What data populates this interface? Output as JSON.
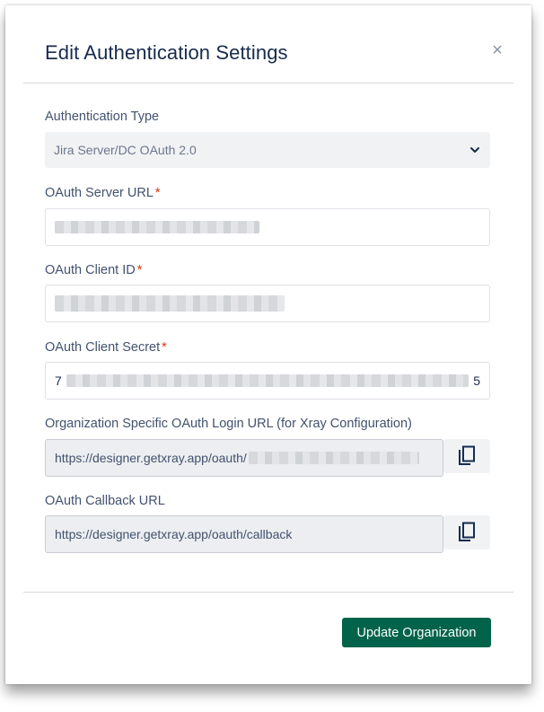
{
  "dialog": {
    "title": "Edit Authentication Settings",
    "close_glyph": "×"
  },
  "fields": {
    "auth_type": {
      "label": "Authentication Type",
      "value": "Jira Server/DC OAuth 2.0"
    },
    "server_url": {
      "label": "OAuth Server URL",
      "required_mark": "*"
    },
    "client_id": {
      "label": "OAuth Client ID",
      "required_mark": "*"
    },
    "client_secret": {
      "label": "OAuth Client Secret",
      "required_mark": "*",
      "value_start": "7",
      "value_end": "5"
    },
    "login_url": {
      "label": "Organization Specific OAuth Login URL (for Xray Configuration)",
      "value": "https://designer.getxray.app/oauth/"
    },
    "callback_url": {
      "label": "OAuth Callback URL",
      "value": "https://designer.getxray.app/oauth/callback"
    }
  },
  "footer": {
    "submit_label": "Update Organization"
  },
  "icons": {
    "close": "close-icon",
    "chevron": "chevron-down-icon",
    "copy": "copy-icon"
  },
  "colors": {
    "primary": "#00634a",
    "required": "#de350b",
    "title": "#172b4d"
  }
}
